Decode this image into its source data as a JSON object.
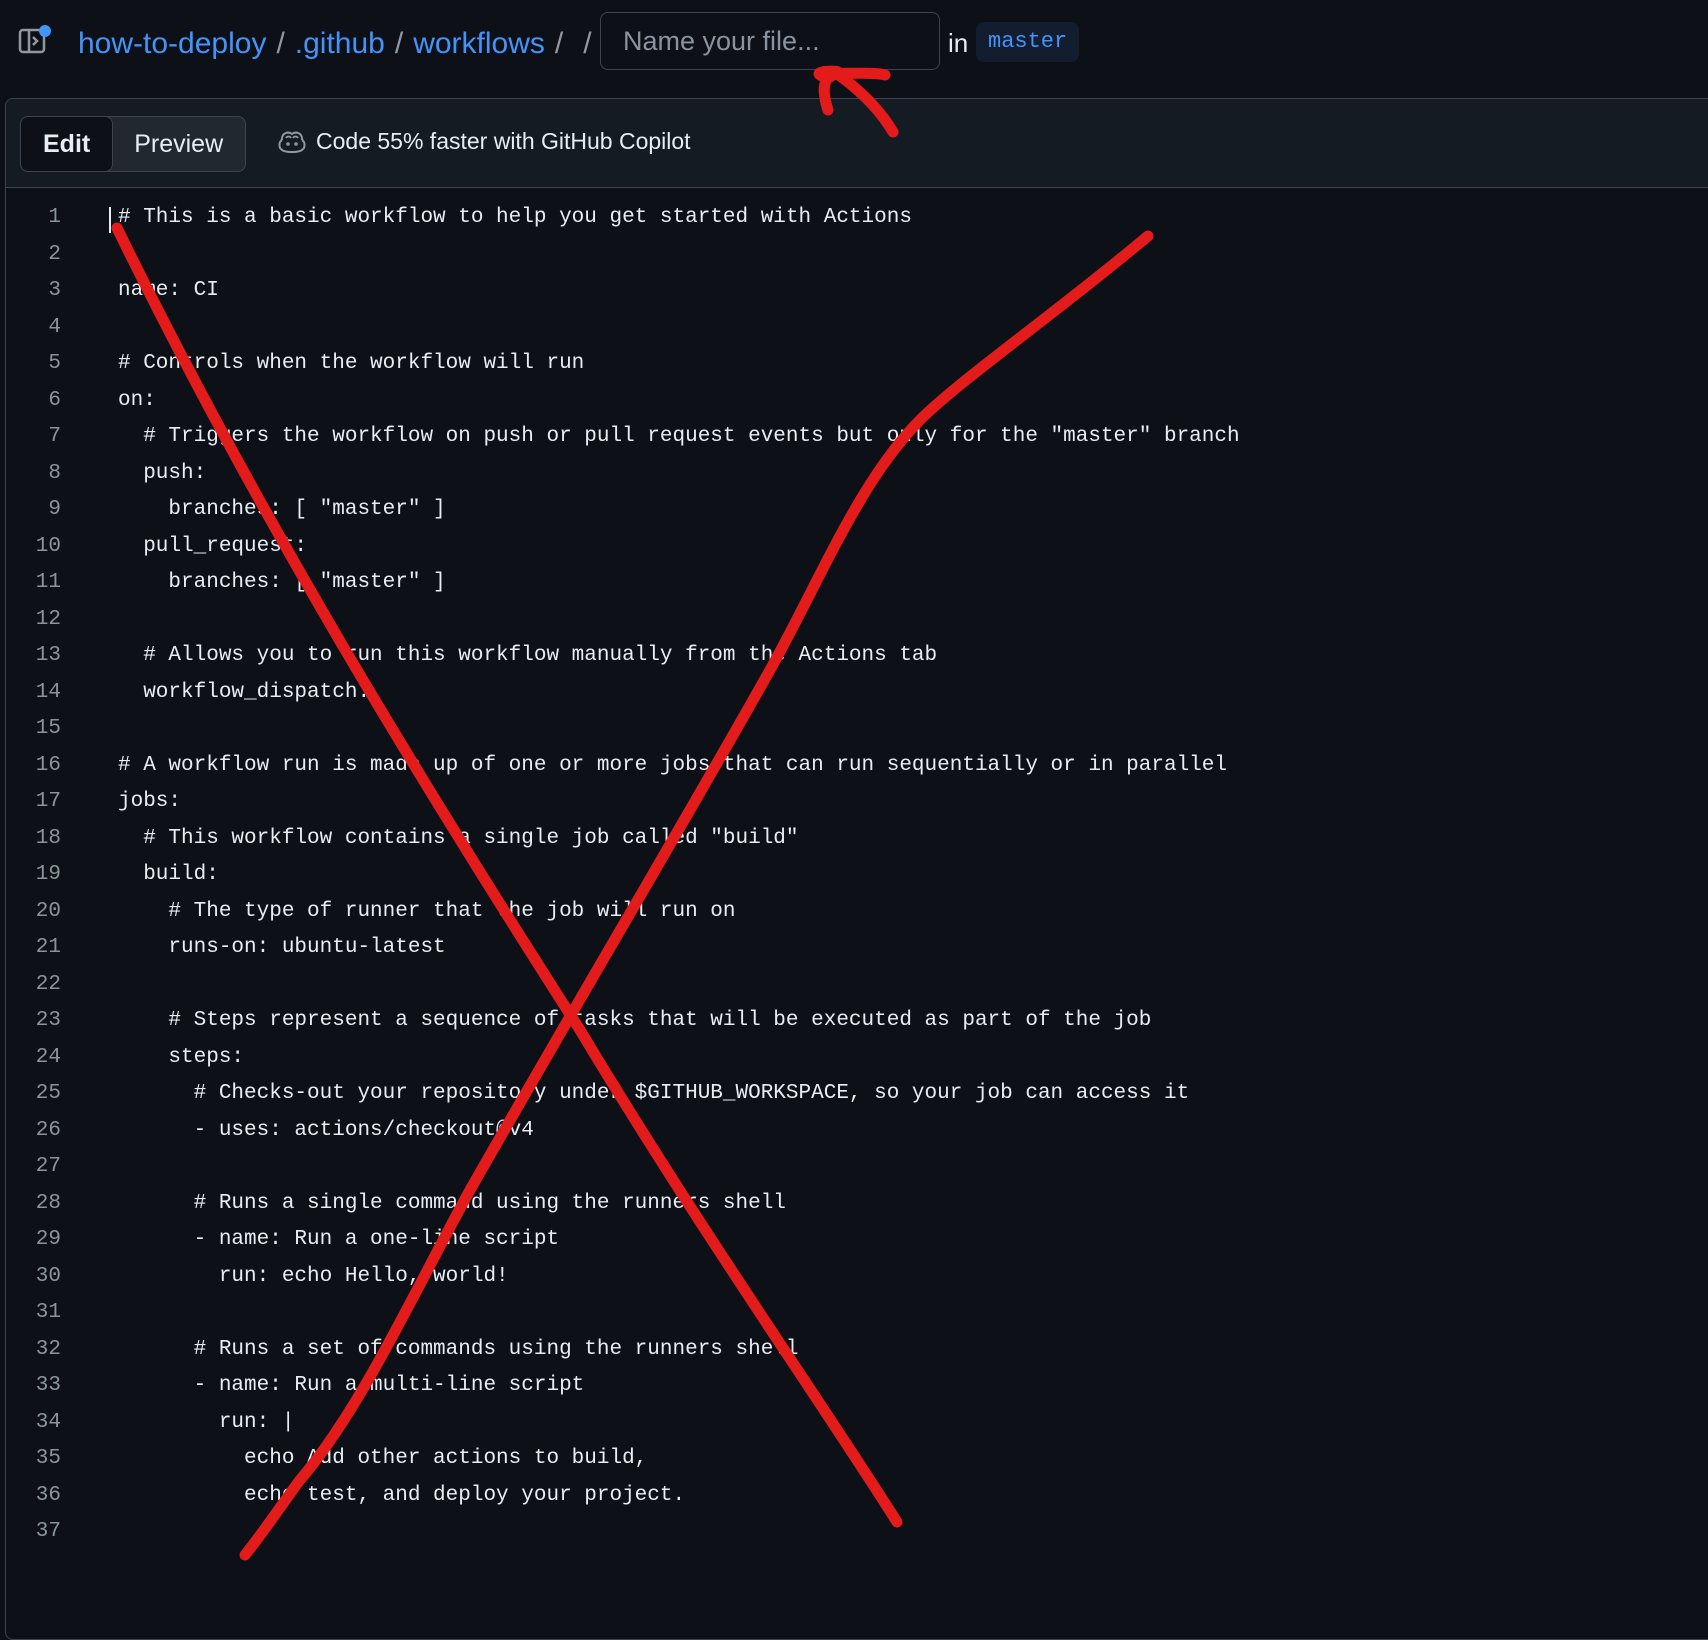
{
  "breadcrumb": {
    "repo": "how-to-deploy",
    "folder1": ".github",
    "folder2": "workflows",
    "sep": "/"
  },
  "filename": {
    "placeholder": "Name your file...",
    "value": ""
  },
  "branch": {
    "in_label": "in",
    "name": "master"
  },
  "editor": {
    "tabs": [
      "Edit",
      "Preview"
    ],
    "active_tab": "Edit",
    "copilot_text": "Code 55% faster with GitHub Copilot"
  },
  "code_lines": [
    "# This is a basic workflow to help you get started with Actions",
    "",
    "name: CI",
    "",
    "# Controls when the workflow will run",
    "on:",
    "  # Triggers the workflow on push or pull request events but only for the \"master\" branch",
    "  push:",
    "    branches: [ \"master\" ]",
    "  pull_request:",
    "    branches: [ \"master\" ]",
    "",
    "  # Allows you to run this workflow manually from the Actions tab",
    "  workflow_dispatch:",
    "",
    "# A workflow run is made up of one or more jobs that can run sequentially or in parallel",
    "jobs:",
    "  # This workflow contains a single job called \"build\"",
    "  build:",
    "    # The type of runner that the job will run on",
    "    runs-on: ubuntu-latest",
    "",
    "    # Steps represent a sequence of tasks that will be executed as part of the job",
    "    steps:",
    "      # Checks-out your repository under $GITHUB_WORKSPACE, so your job can access it",
    "      - uses: actions/checkout@v4",
    "",
    "      # Runs a single command using the runners shell",
    "      - name: Run a one-line script",
    "        run: echo Hello, world!",
    "",
    "      # Runs a set of commands using the runners shell",
    "      - name: Run a multi-line script",
    "        run: |",
    "          echo Add other actions to build,",
    "          echo test, and deploy your project.",
    ""
  ],
  "colors": {
    "background": "#0d1117",
    "link": "#4493f8",
    "annotation": "#e31b1b"
  },
  "icons": {
    "sidebar_toggle": "sidebar-expand-icon",
    "copilot": "copilot-icon"
  }
}
